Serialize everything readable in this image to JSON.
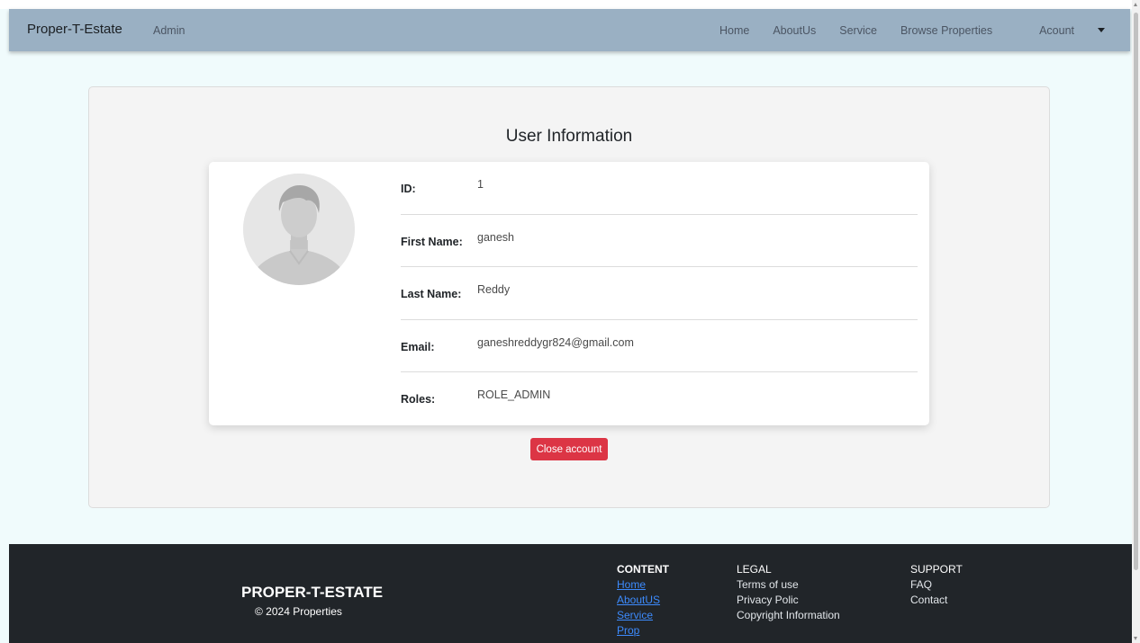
{
  "navbar": {
    "brand": "Proper-T-Estate",
    "admin": "Admin",
    "links": [
      "Home",
      "AboutUs",
      "Service",
      "Browse Properties",
      "Acount"
    ]
  },
  "main": {
    "title": "User Information",
    "fields": [
      {
        "label": "ID:",
        "value": "1"
      },
      {
        "label": "First Name:",
        "value": "ganesh"
      },
      {
        "label": "Last Name:",
        "value": "Reddy"
      },
      {
        "label": "Email:",
        "value": "ganeshreddygr824@gmail.com"
      },
      {
        "label": "Roles:",
        "value": "ROLE_ADMIN"
      }
    ],
    "close_button": "Close account"
  },
  "footer": {
    "brand": "PROPER-T-ESTATE",
    "copyright": "© 2024 Properties",
    "content_heading": "CONTENT",
    "content_links": [
      "Home",
      "AboutUS",
      "Service",
      "Prop"
    ],
    "legal_heading": "LEGAL",
    "legal_items": [
      "Terms of use",
      "Privacy Polic",
      "Copyright Information"
    ],
    "support_heading": "SUPPORT",
    "support_items": [
      "FAQ",
      "Contact"
    ]
  },
  "colors": {
    "navbar": "#9ab0c3",
    "page_bg": "#f0fbfc",
    "danger": "#dc3545",
    "footer": "#212529",
    "link": "#3d8bfd"
  }
}
